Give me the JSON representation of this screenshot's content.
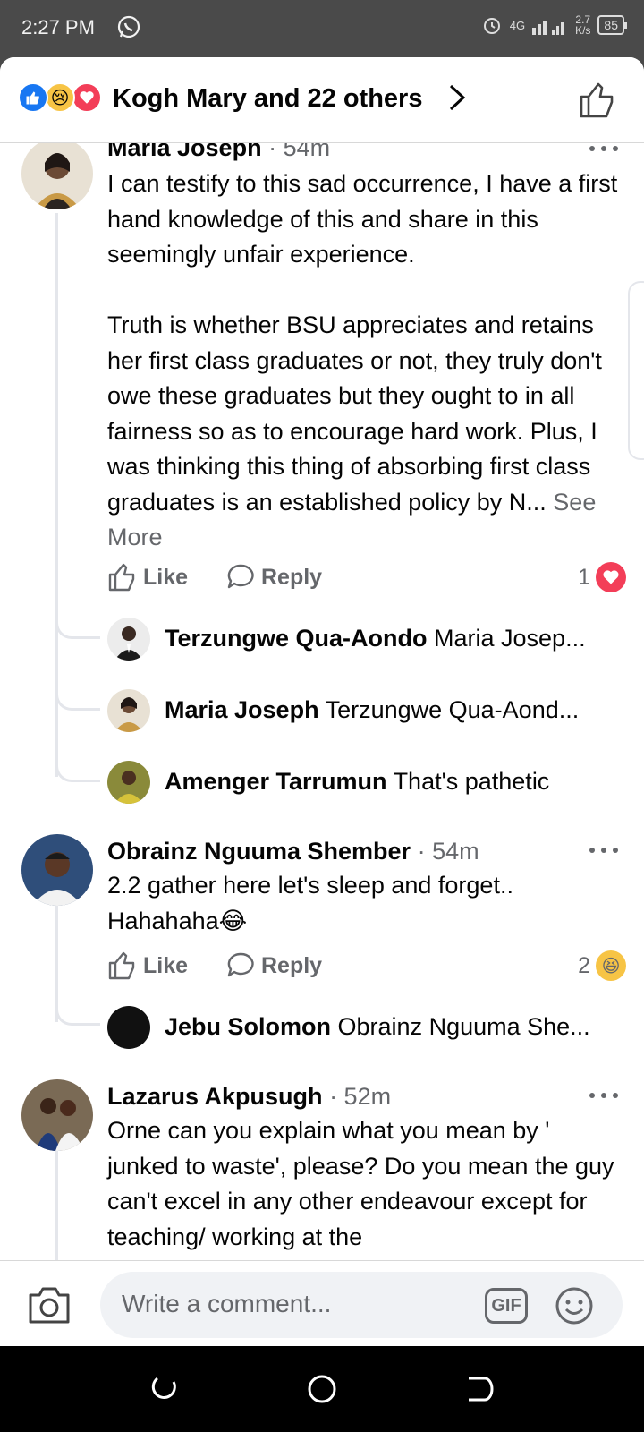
{
  "status_bar": {
    "time": "2:27 PM",
    "network": "4G",
    "speed_value": "2.7",
    "speed_unit": "K/s",
    "battery": "85"
  },
  "header": {
    "reactions_text": "Kogh Mary and 22 others",
    "reaction_icons": [
      "like",
      "sad",
      "love"
    ]
  },
  "comments": [
    {
      "author": "Maria Joseph",
      "time": "· 54m",
      "text": "I can testify to this sad occurrence, I have a first hand knowledge of this and share in this seemingly unfair experience.\n\nTruth is whether BSU appreciates and retains her first class graduates or not, they truly don't owe these graduates but they ought to in all fairness so as to encourage hard work. Plus, I was thinking this thing of absorbing first class graduates is an established policy by N...",
      "see_more": "See More",
      "like_label": "Like",
      "reply_label": "Reply",
      "reaction_count": "1",
      "reaction_type": "love",
      "replies": [
        {
          "author": "Terzungwe Qua-Aondo",
          "text": "Maria Josep..."
        },
        {
          "author": "Maria Joseph",
          "text": "Terzungwe Qua-Aond..."
        },
        {
          "author": "Amenger Tarrumun",
          "text": "That's pathetic"
        }
      ]
    },
    {
      "author": "Obrainz Nguuma Shember",
      "time": "· 54m",
      "text": "2.2 gather here let's sleep and forget.. Hahahaha😂",
      "like_label": "Like",
      "reply_label": "Reply",
      "reaction_count": "2",
      "reaction_type": "haha",
      "replies": [
        {
          "author": "Jebu Solomon",
          "text": "Obrainz Nguuma She..."
        }
      ]
    },
    {
      "author": "Lazarus Akpusugh",
      "time": "· 52m",
      "text": "Orne can you explain what you mean by ' junked to waste', please? Do you mean the guy can't excel in any other endeavour except for teaching/ working at the"
    }
  ],
  "composer": {
    "placeholder": "Write a comment...",
    "gif_label": "GIF"
  },
  "colors": {
    "accent": "#1877f2",
    "love": "#f33e58",
    "haha": "#f7c445",
    "muted_text": "#65676b"
  }
}
